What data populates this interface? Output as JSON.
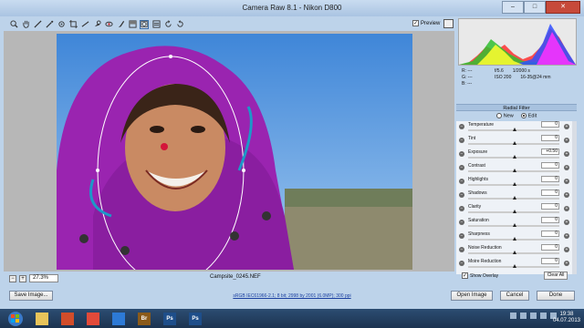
{
  "window": {
    "title": "Camera Raw 8.1  -  Nikon D800",
    "minimize": "–",
    "maximize": "□",
    "close": "✕"
  },
  "toolbar": {
    "tools": [
      "zoom-icon",
      "hand-icon",
      "white-balance-icon",
      "color-sampler-icon",
      "target-adjust-icon",
      "crop-icon",
      "straighten-icon",
      "spot-removal-icon",
      "red-eye-icon",
      "adjustment-brush-icon",
      "graduated-filter-icon",
      "radial-filter-icon",
      "preferences-icon",
      "rotate-ccw-icon",
      "rotate-cw-icon"
    ],
    "preview_label": "Preview",
    "preview_checked": "✓"
  },
  "image": {
    "zoom": "27.3%",
    "filename": "Campsite_0245.NEF"
  },
  "histogram": {
    "colors": [
      "#ff3030",
      "#30c030",
      "#3050ff",
      "#ffff30",
      "#ff30ff"
    ]
  },
  "info": {
    "r_label": "R:",
    "g_label": "G:",
    "b_label": "B:",
    "r_value": "---",
    "g_value": "---",
    "b_value": "---",
    "aperture": "f/5.6",
    "shutter": "1/2000 s",
    "iso": "ISO 200",
    "lens": "16-35@24 mm"
  },
  "panel": {
    "title": "Radial Filter",
    "new_label": "New",
    "edit_label": "Edit",
    "sliders": [
      {
        "label": "Temperature",
        "value": "0"
      },
      {
        "label": "Tint",
        "value": "0"
      },
      {
        "label": "Exposure",
        "value": "+0.50"
      },
      {
        "label": "Contrast",
        "value": "0"
      },
      {
        "label": "Highlights",
        "value": "0"
      },
      {
        "label": "Shadows",
        "value": "0"
      },
      {
        "label": "Clarity",
        "value": "0"
      },
      {
        "label": "Saturation",
        "value": "0"
      },
      {
        "label": "Sharpness",
        "value": "0"
      },
      {
        "label": "Noise Reduction",
        "value": "0"
      },
      {
        "label": "Moire Reduction",
        "value": "0"
      }
    ],
    "show_overlay_label": "Show Overlay",
    "show_overlay_checked": "✓",
    "clear_all_label": "Clear All"
  },
  "bottom": {
    "save_label": "Save Image...",
    "workflow_link": "sRGB IEC61966-2.1; 8 bit; 2998 by 2001 (6.0MP); 300 ppi",
    "open_label": "Open Image",
    "cancel_label": "Cancel",
    "done_label": "Done"
  },
  "taskbar": {
    "apps": [
      "explorer-icon",
      "media-player-icon",
      "chrome-icon",
      "snowflake-icon",
      "bridge-icon",
      "photoshop-icon",
      "photoshop-icon"
    ],
    "app_labels": [
      "",
      "",
      "",
      "",
      "Br",
      "Ps",
      "Ps"
    ],
    "time": "19:38",
    "date": "04.07.2013"
  }
}
